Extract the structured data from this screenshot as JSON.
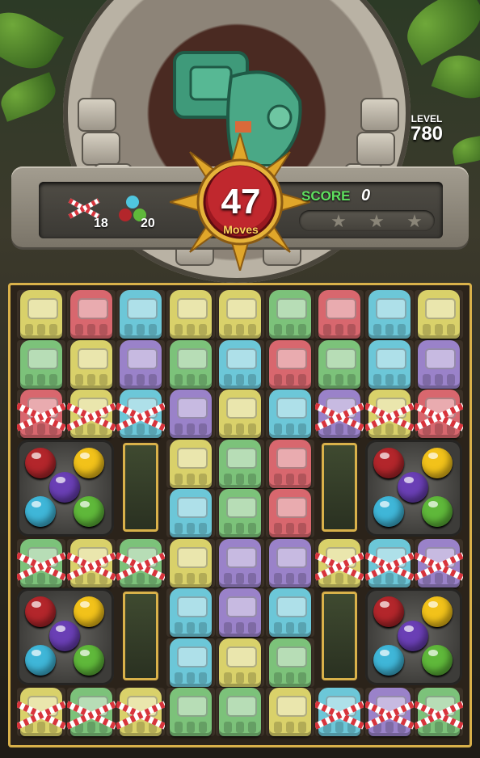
{
  "hud": {
    "level_label": "LEVEL",
    "level_value": "780",
    "moves_value": "47",
    "moves_label": "Moves",
    "score_label": "SCORE",
    "score_value": "0",
    "stars_total": 3,
    "stars_earned": 0
  },
  "goals": [
    {
      "icon": "candy-cage-icon",
      "count": "18"
    },
    {
      "icon": "colored-orbs-icon",
      "count": "20"
    }
  ],
  "colors": {
    "yellow": "#d9d16a",
    "red": "#d8676e",
    "blue": "#6cc7d8",
    "green": "#7cc27a",
    "purple": "#9a82c9",
    "board_border": "#d9b14a"
  },
  "board": {
    "columns": 9,
    "rows": [
      [
        "yellow",
        "red",
        "blue",
        "yellow",
        "yellow",
        "green",
        "red",
        "blue",
        "yellow"
      ],
      [
        "green",
        "yellow",
        "purple",
        "green",
        "blue",
        "red",
        "green",
        "blue",
        "purple"
      ],
      [
        "red*",
        "yellow*",
        "blue*",
        "purple",
        "yellow",
        "blue",
        "purple*",
        "yellow*",
        "red*"
      ],
      [
        "orb",
        "orb",
        "slot",
        "yellow",
        "green",
        "red",
        "slot",
        "orb",
        "orb"
      ],
      [
        "orb",
        "orb",
        "slot",
        "blue",
        "green",
        "red",
        "slot",
        "orb",
        "orb"
      ],
      [
        "green*",
        "yellow*",
        "green*",
        "yellow",
        "purple",
        "purple",
        "yellow*",
        "blue*",
        "purple*"
      ],
      [
        "orb",
        "orb",
        "slot",
        "blue",
        "purple",
        "blue",
        "slot",
        "orb",
        "orb"
      ],
      [
        "orb",
        "orb",
        "slot",
        "blue",
        "yellow",
        "green",
        "slot",
        "orb",
        "orb"
      ],
      [
        "yellow*",
        "green*",
        "yellow*",
        "green",
        "green",
        "yellow",
        "blue*",
        "purple*",
        "green*"
      ]
    ],
    "orb_colors": [
      "#b3262b",
      "#f2c21a",
      "#6a3fb5",
      "#3fb6d8",
      "#5fb83a"
    ]
  }
}
